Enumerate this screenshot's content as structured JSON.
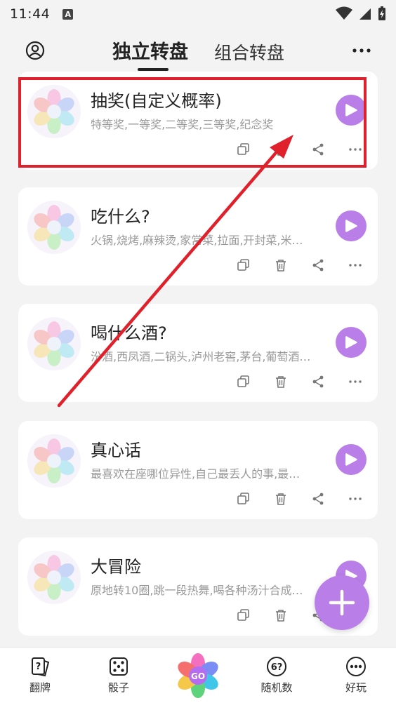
{
  "status_bar": {
    "time": "11:44",
    "notif_letter": "A"
  },
  "header": {
    "tabs": [
      {
        "label": "独立转盘",
        "active": true
      },
      {
        "label": "组合转盘",
        "active": false
      }
    ]
  },
  "cards": [
    {
      "title": "抽奖(自定义概率)",
      "subtitle": "特等奖,一等奖,二等奖,三等奖,纪念奖"
    },
    {
      "title": "吃什么?",
      "subtitle": "火锅,烧烤,麻辣烫,家常菜,拉面,开封菜,米…"
    },
    {
      "title": "喝什么酒?",
      "subtitle": "汾酒,西凤酒,二锅头,泸州老窖,茅台,葡萄酒…"
    },
    {
      "title": "真心话",
      "subtitle": "最喜欢在座哪位异性,自己最丢人的事,最…"
    },
    {
      "title": "大冒险",
      "subtitle": "原地转10圈,跳一段热舞,喝各种汤汁合成…"
    }
  ],
  "bottom_nav": {
    "items": [
      {
        "label": "翻牌",
        "icon": "cards-icon"
      },
      {
        "label": "骰子",
        "icon": "dice-icon"
      },
      {
        "label": "",
        "icon": "go-wheel-icon",
        "go_text": "GO"
      },
      {
        "label": "随机数",
        "icon": "random-number-icon",
        "glyph": "6?"
      },
      {
        "label": "好玩",
        "icon": "more-dots-icon"
      }
    ]
  },
  "colors": {
    "accent": "#b97ee8",
    "annotation_red": "#e0202b",
    "background": "#f3f3f3"
  }
}
